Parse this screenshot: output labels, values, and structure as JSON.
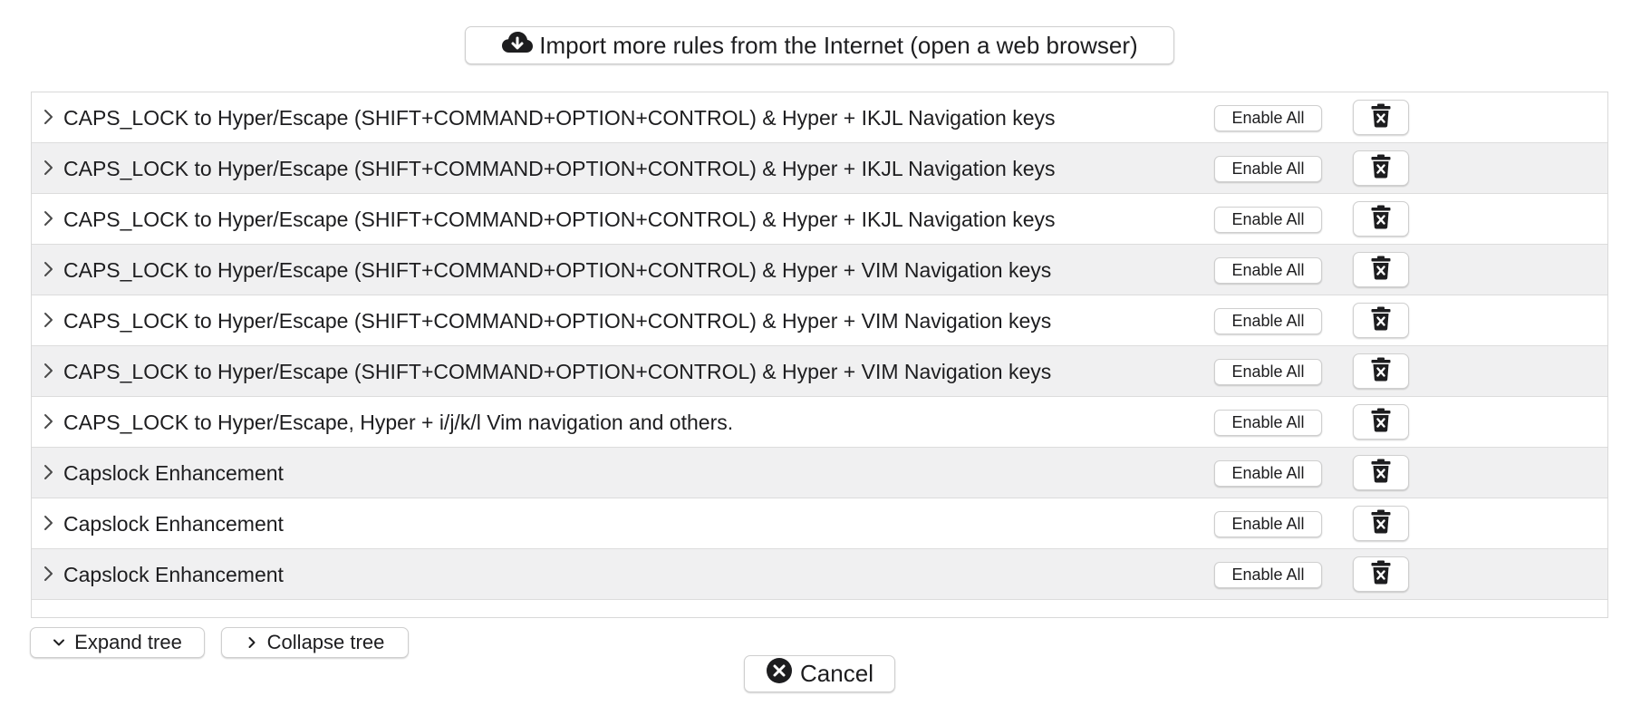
{
  "import_button": {
    "label": "Import more rules from the Internet (open a web browser)",
    "icon": "cloud-download-icon"
  },
  "rules": [
    {
      "title": "CAPS_LOCK to Hyper/Escape (SHIFT+COMMAND+OPTION+CONTROL) & Hyper + IKJL Navigation keys",
      "enable_label": "Enable All"
    },
    {
      "title": "CAPS_LOCK to Hyper/Escape (SHIFT+COMMAND+OPTION+CONTROL) & Hyper + IKJL Navigation keys",
      "enable_label": "Enable All"
    },
    {
      "title": "CAPS_LOCK to Hyper/Escape (SHIFT+COMMAND+OPTION+CONTROL) & Hyper + IKJL Navigation keys",
      "enable_label": "Enable All"
    },
    {
      "title": "CAPS_LOCK to Hyper/Escape (SHIFT+COMMAND+OPTION+CONTROL) & Hyper + VIM Navigation keys",
      "enable_label": "Enable All"
    },
    {
      "title": "CAPS_LOCK to Hyper/Escape (SHIFT+COMMAND+OPTION+CONTROL) & Hyper + VIM Navigation keys",
      "enable_label": "Enable All"
    },
    {
      "title": "CAPS_LOCK to Hyper/Escape (SHIFT+COMMAND+OPTION+CONTROL) & Hyper + VIM Navigation keys",
      "enable_label": "Enable All"
    },
    {
      "title": "CAPS_LOCK to Hyper/Escape, Hyper + i/j/k/l Vim navigation and others.",
      "enable_label": "Enable All"
    },
    {
      "title": "Capslock Enhancement",
      "enable_label": "Enable All"
    },
    {
      "title": "Capslock Enhancement",
      "enable_label": "Enable All"
    },
    {
      "title": "Capslock Enhancement",
      "enable_label": "Enable All"
    }
  ],
  "tree_controls": {
    "expand_label": "Expand tree",
    "collapse_label": "Collapse tree"
  },
  "cancel_button": {
    "label": "Cancel",
    "icon": "close-circle-icon"
  },
  "colors": {
    "row_alt_background": "#f0f0f1",
    "border": "#d9d9d9",
    "text": "#1d1d1f"
  }
}
